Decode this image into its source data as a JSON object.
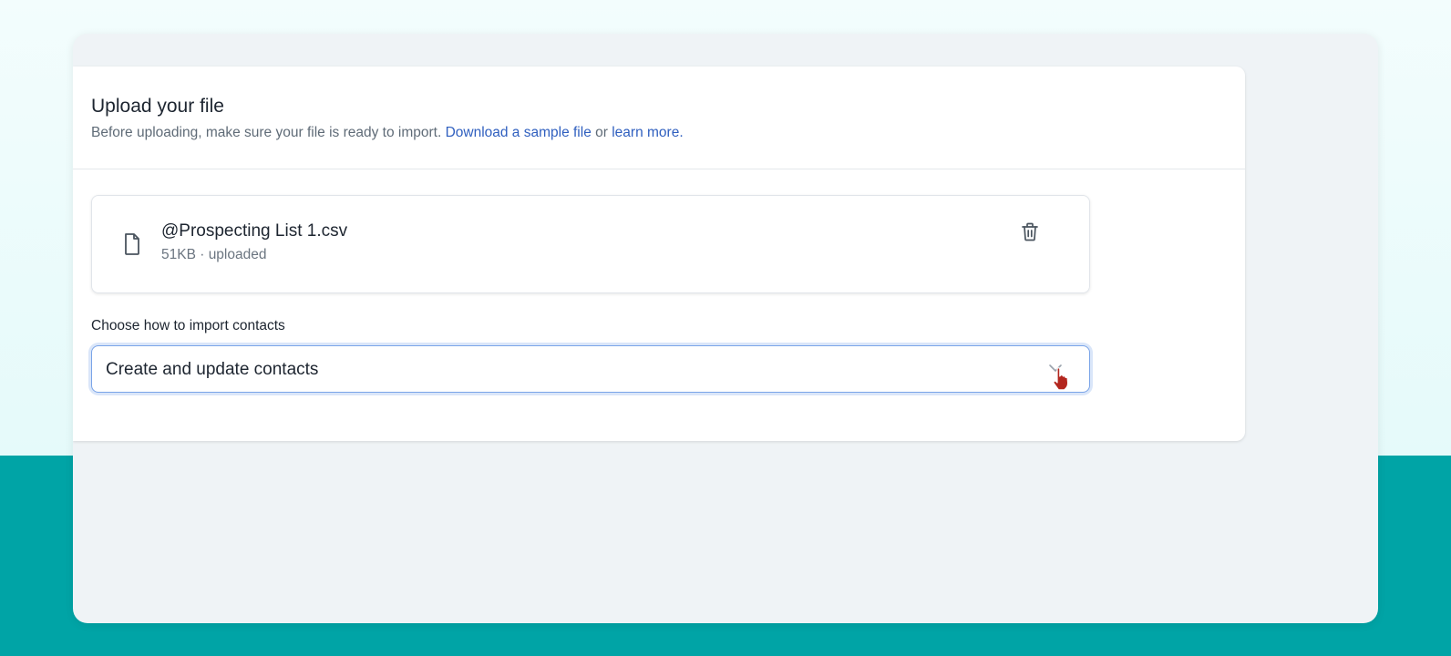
{
  "upload": {
    "title": "Upload your file",
    "subtitle_prefix": "Before uploading, make sure your file is ready to import. ",
    "download_link": "Download a sample file",
    "or_text": " or ",
    "learn_link": "learn more."
  },
  "file": {
    "name": "@Prospecting List 1.csv",
    "meta": "51KB · uploaded",
    "icon": "file-icon",
    "delete_icon": "trash-icon"
  },
  "import": {
    "label": "Choose how to import contacts",
    "selected": "Create and update contacts",
    "icon": "chevron-down-icon"
  },
  "colors": {
    "link": "#2f5fbf",
    "teal_band": "#00a4a6",
    "focus_ring": "#7aa4e8",
    "cursor": "#b3261e"
  }
}
